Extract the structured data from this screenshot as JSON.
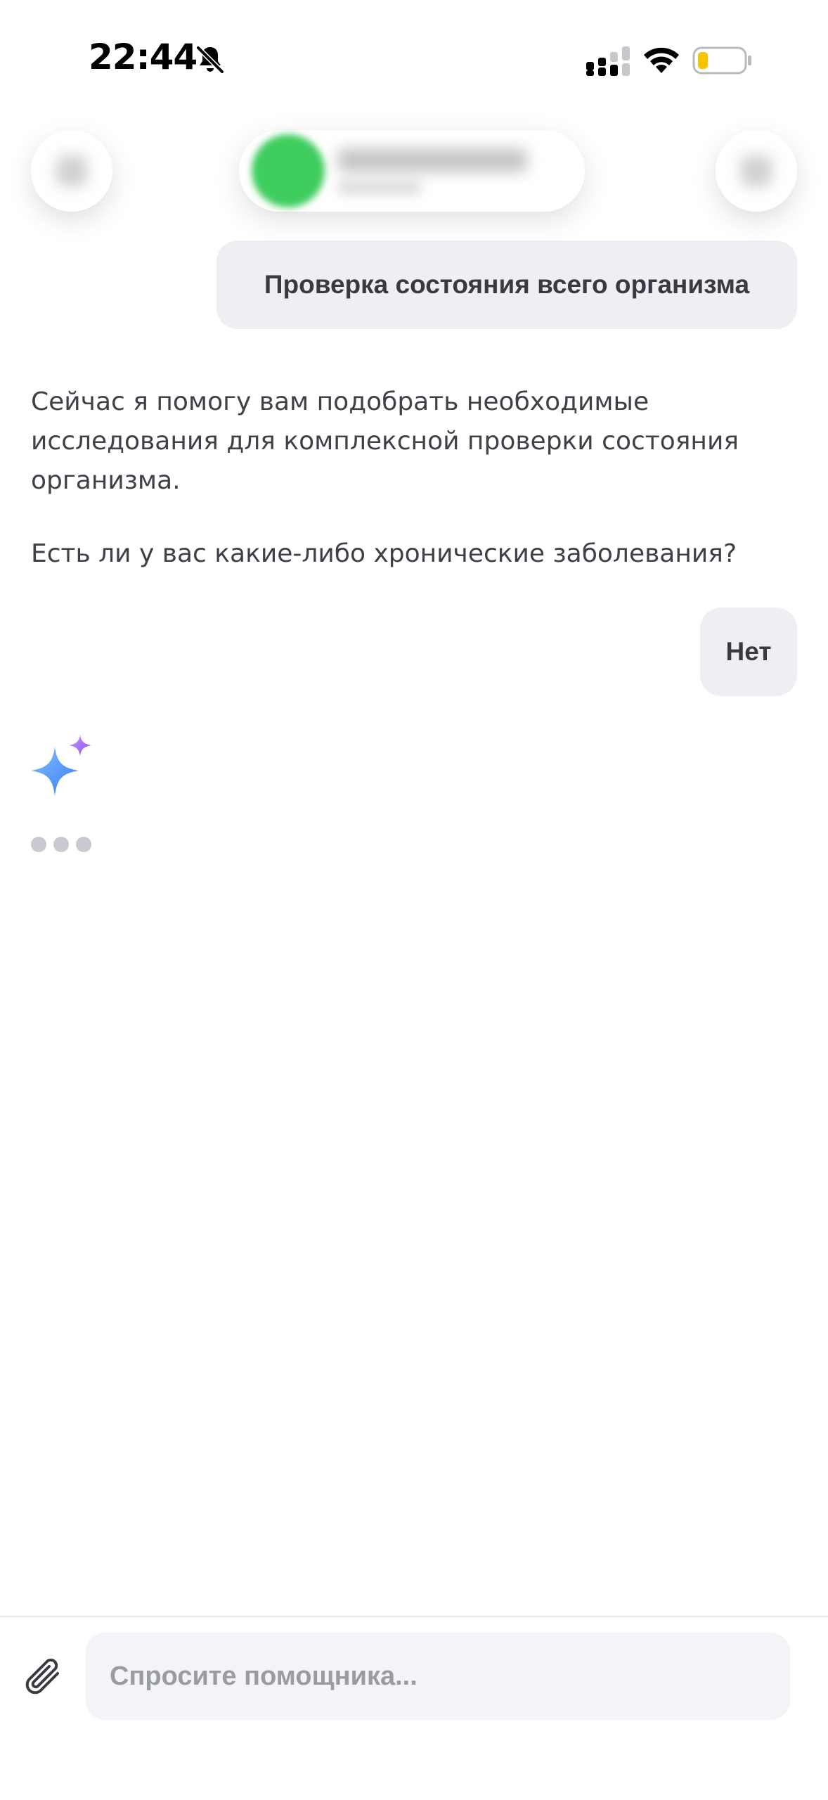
{
  "status_bar": {
    "time": "22:44",
    "icons": [
      "bell-slash-icon",
      "cellular-signal-icon",
      "wifi-icon",
      "battery-low-icon"
    ],
    "battery_color": "#f6c400"
  },
  "header": {
    "left_button_icon": "back-icon",
    "right_button_icon": "menu-icon",
    "avatar_color": "#3fcd5e"
  },
  "messages": [
    {
      "role": "user",
      "text": "Проверка состояния всего организма"
    },
    {
      "role": "assistant",
      "paragraphs": [
        "Сейчас я помогу вам подобрать необходимые исследования для комплексной проверки состояния организма.",
        "Есть ли у вас какие-либо хронические заболевания?"
      ]
    },
    {
      "role": "user",
      "text": "Нет"
    }
  ],
  "assistant_typing": {
    "icon": "sparkles-icon"
  },
  "composer": {
    "placeholder": "Спросите помощника...",
    "value": "",
    "attach_icon": "paperclip-icon"
  }
}
